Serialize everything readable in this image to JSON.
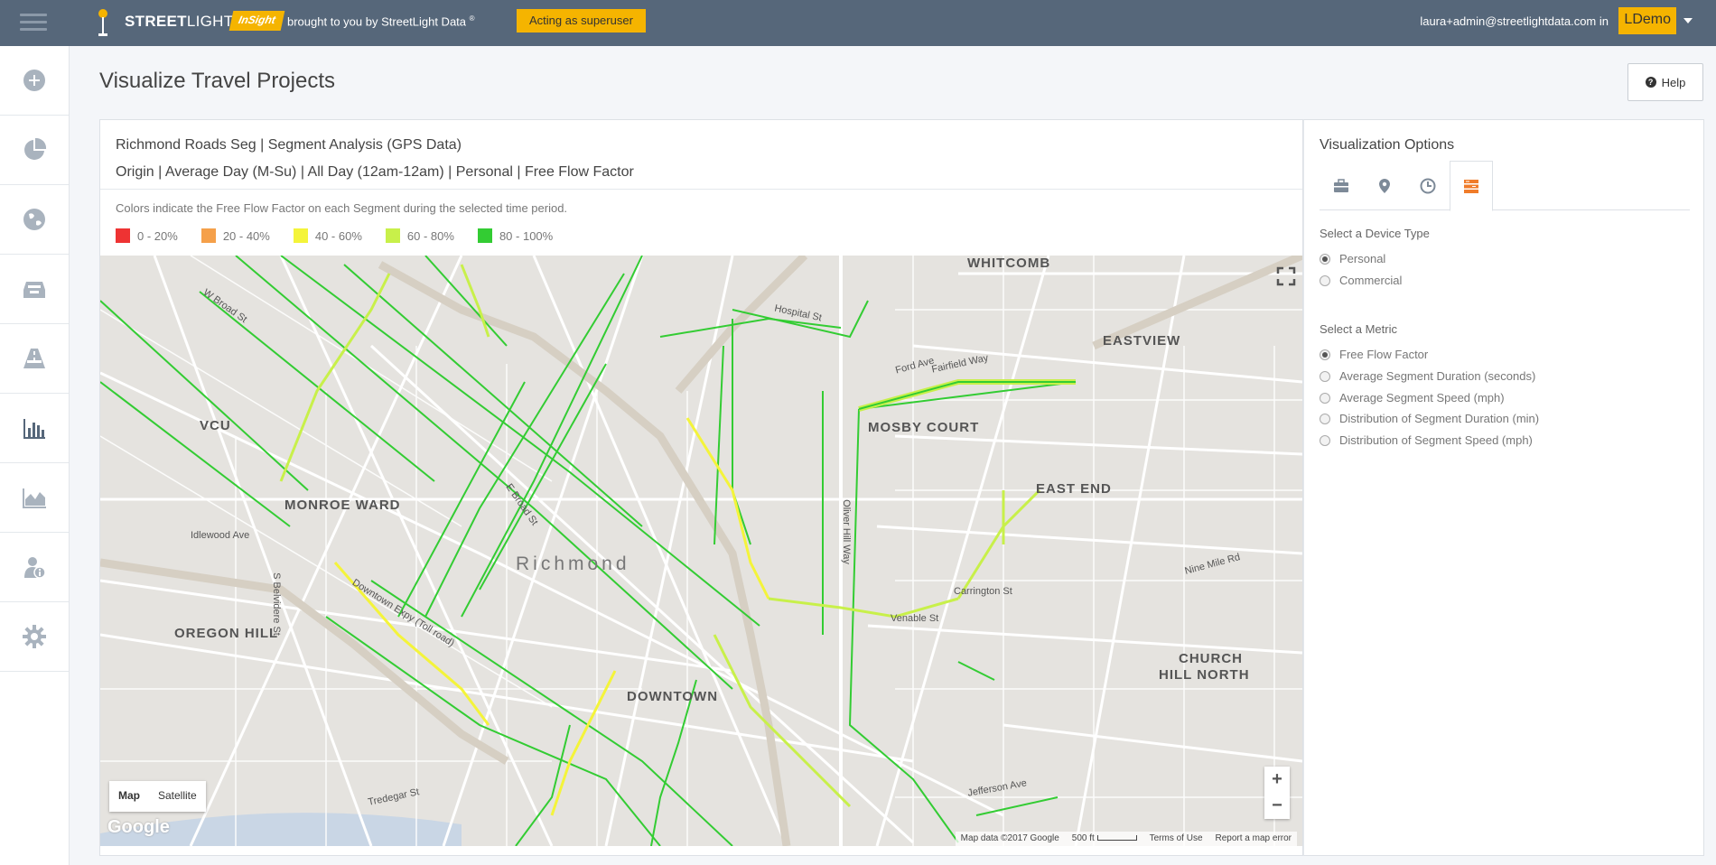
{
  "header": {
    "brand_bold": "STREET",
    "brand_light": "LIGHT",
    "insight": "InSight",
    "brought_by": "brought to you by StreetLight Data",
    "registered": "®",
    "superuser": "Acting as superuser",
    "user": "laura+admin@streetlightdata.com in",
    "org": "LDemo"
  },
  "sidebar": {
    "items": [
      {
        "icon": "plus-circle-icon"
      },
      {
        "icon": "pie-chart-icon"
      },
      {
        "icon": "globe-icon"
      },
      {
        "icon": "inbox-icon"
      },
      {
        "icon": "road-icon"
      },
      {
        "icon": "bar-chart-icon",
        "active": true
      },
      {
        "icon": "area-chart-icon"
      },
      {
        "icon": "user-info-icon"
      },
      {
        "icon": "gear-icon"
      }
    ]
  },
  "page": {
    "title": "Visualize Travel Projects",
    "help": "Help"
  },
  "project": {
    "line1": "Richmond Roads Seg | Segment Analysis (GPS Data)",
    "line2": "Origin | Average Day (M-Su) | All Day (12am-12am) | Personal | Free Flow Factor",
    "legend_desc": "Colors indicate the Free Flow Factor on each Segment during the selected time period.",
    "legend": [
      {
        "label": "0 - 20%",
        "color": "#ee3333"
      },
      {
        "label": "20 - 40%",
        "color": "#f5a04a"
      },
      {
        "label": "40 - 60%",
        "color": "#f4f43a"
      },
      {
        "label": "60 - 80%",
        "color": "#c8f04a"
      },
      {
        "label": "80 - 100%",
        "color": "#33cc33"
      }
    ]
  },
  "map": {
    "labels": {
      "whitcomb": "WHITCOMB",
      "eastview": "EASTVIEW",
      "vcu": "VCU",
      "mosby": "MOSBY COURT",
      "eastend": "EAST END",
      "monroe": "MONROE WARD",
      "richmond": "Richmond",
      "oregon": "OREGON HILL",
      "church1": "CHURCH",
      "church2": "HILL NORTH",
      "downtown": "DOWNTOWN",
      "wbroad": "W Broad St",
      "ebroad": "E Broad St",
      "oliver": "Oliver Hill Way",
      "fairfield": "Fairfield Way",
      "venable": "Venable St",
      "downtownexpy": "Downtown Expy (Toll road)",
      "jefferson": "Jefferson Ave",
      "idlewood": "Idlewood Ave",
      "belvidere": "S Belvidere St",
      "carrington": "Carrington St",
      "ninemile": "Nine Mile Rd",
      "hospital": "Hospital St",
      "fordave": "Ford Ave",
      "tredegar": "Tredegar St"
    },
    "map_btn": "Map",
    "satellite_btn": "Satellite",
    "zoom_in": "+",
    "zoom_out": "−",
    "google": "Google",
    "map_data": "Map data ©2017 Google",
    "scale": "500 ft",
    "terms": "Terms of Use",
    "report": "Report a map error"
  },
  "viz_options": {
    "title": "Visualization Options",
    "tabs": [
      {
        "icon": "briefcase-icon"
      },
      {
        "icon": "map-marker-icon"
      },
      {
        "icon": "clock-icon"
      },
      {
        "icon": "layers-icon",
        "active": true
      }
    ],
    "device_label": "Select a Device Type",
    "devices": [
      {
        "label": "Personal",
        "checked": true
      },
      {
        "label": "Commercial",
        "checked": false
      }
    ],
    "metric_label": "Select a Metric",
    "metrics": [
      {
        "label": "Free Flow Factor",
        "checked": true
      },
      {
        "label": "Average Segment Duration (seconds)",
        "checked": false
      },
      {
        "label": "Average Segment Speed (mph)",
        "checked": false
      },
      {
        "label": "Distribution of Segment Duration (min)",
        "checked": false
      },
      {
        "label": "Distribution of Segment Speed (mph)",
        "checked": false
      }
    ]
  }
}
